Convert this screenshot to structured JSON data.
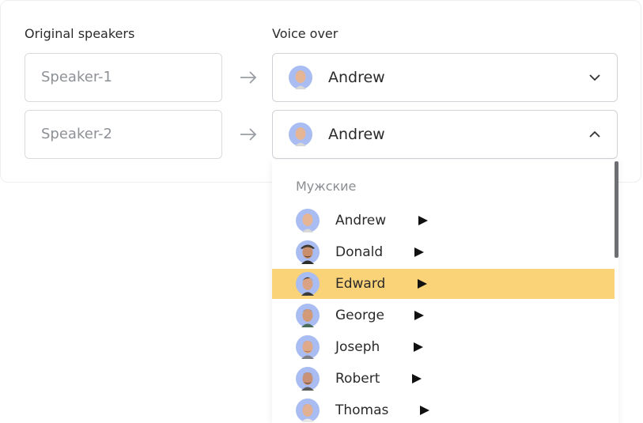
{
  "columns": {
    "original": "Original speakers",
    "voice_over": "Voice over"
  },
  "rows": [
    {
      "speaker_placeholder": "Speaker-1",
      "voice": "Andrew",
      "expanded": false
    },
    {
      "speaker_placeholder": "Speaker-2",
      "voice": "Andrew",
      "expanded": true
    }
  ],
  "dropdown": {
    "group_label": "Мужские",
    "selected_index": 2,
    "options": [
      {
        "name": "Andrew",
        "avatar": "avatar-andrew"
      },
      {
        "name": "Donald",
        "avatar": "avatar-donald"
      },
      {
        "name": "Edward",
        "avatar": "avatar-edward"
      },
      {
        "name": "George",
        "avatar": "avatar-george"
      },
      {
        "name": "Joseph",
        "avatar": "avatar-joseph"
      },
      {
        "name": "Robert",
        "avatar": "avatar-robert"
      },
      {
        "name": "Thomas",
        "avatar": "avatar-thomas"
      }
    ]
  },
  "colors": {
    "highlight": "#fad277",
    "avatar_bg": "#a9bdf2"
  }
}
